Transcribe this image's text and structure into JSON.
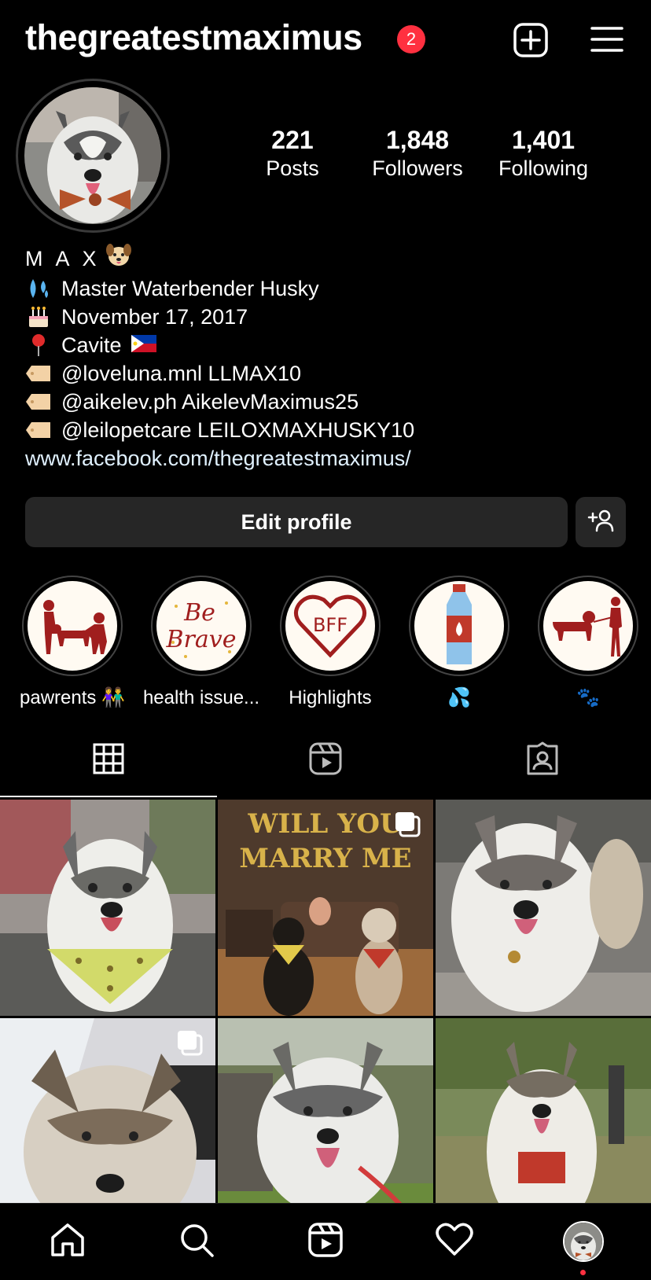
{
  "header": {
    "username": "thegreatestmaximus",
    "notification_count": "2",
    "add_icon": "plus-square-icon",
    "menu_icon": "hamburger-menu-icon"
  },
  "stats": {
    "posts": {
      "value": "221",
      "label": "Posts"
    },
    "followers": {
      "value": "1,848",
      "label": "Followers"
    },
    "following": {
      "value": "1,401",
      "label": "Following"
    }
  },
  "bio": {
    "name": "M A X",
    "name_emoji": "dog-face-icon",
    "lines": [
      {
        "icon": "sweat-droplets-icon",
        "text": "Master Waterbender Husky"
      },
      {
        "icon": "birthday-cake-icon",
        "text": "November 17, 2017"
      },
      {
        "icon": "pin-icon",
        "text": "Cavite",
        "flag": "philippines-flag-icon"
      },
      {
        "icon": "label-tag-icon",
        "text": "@loveluna.mnl LLMAX10"
      },
      {
        "icon": "label-tag-icon",
        "text": "@aikelev.ph AikelevMaximus25"
      },
      {
        "icon": "label-tag-icon",
        "text": "@leilopetcare LEILOXMAXHUSKY10"
      }
    ],
    "link": "www.facebook.com/thegreatestmaximus/"
  },
  "buttons": {
    "edit_profile": "Edit profile",
    "discover_people_icon": "add-person-icon"
  },
  "highlights": [
    {
      "label": "pawrents 👫",
      "icon": "family-dog-icon"
    },
    {
      "label": "health issue...",
      "icon": "be-brave-icon"
    },
    {
      "label": "Highlights",
      "icon": "bff-heart-icon"
    },
    {
      "label": "💦",
      "icon": "water-bottle-icon"
    },
    {
      "label": "🐾",
      "icon": "dog-walk-icon"
    }
  ],
  "tabs": [
    {
      "name": "posts-grid",
      "icon": "grid-icon",
      "active": true
    },
    {
      "name": "reels",
      "icon": "reels-icon",
      "active": false
    },
    {
      "name": "tagged",
      "icon": "tagged-person-icon",
      "active": false
    }
  ],
  "grid": [
    {
      "subject": "husky-yellow-bandana",
      "multi": false
    },
    {
      "subject": "will-you-marry-me-dogs",
      "multi": true
    },
    {
      "subject": "husky-smiling",
      "multi": false
    },
    {
      "subject": "husky-with-cone",
      "multi": true
    },
    {
      "subject": "husky-lying-grass",
      "multi": false
    },
    {
      "subject": "husky-red-harness",
      "multi": false
    }
  ],
  "bottom_nav": [
    {
      "name": "home",
      "icon": "home-icon"
    },
    {
      "name": "search",
      "icon": "search-icon"
    },
    {
      "name": "reels",
      "icon": "reels-icon"
    },
    {
      "name": "activity",
      "icon": "heart-icon"
    },
    {
      "name": "profile",
      "icon": "profile-avatar-icon"
    }
  ],
  "colors": {
    "background": "#000000",
    "badge": "#ff3040",
    "button_bg": "#262626",
    "link": "#e0f1ff",
    "highlight_accent": "#a01e1e"
  }
}
